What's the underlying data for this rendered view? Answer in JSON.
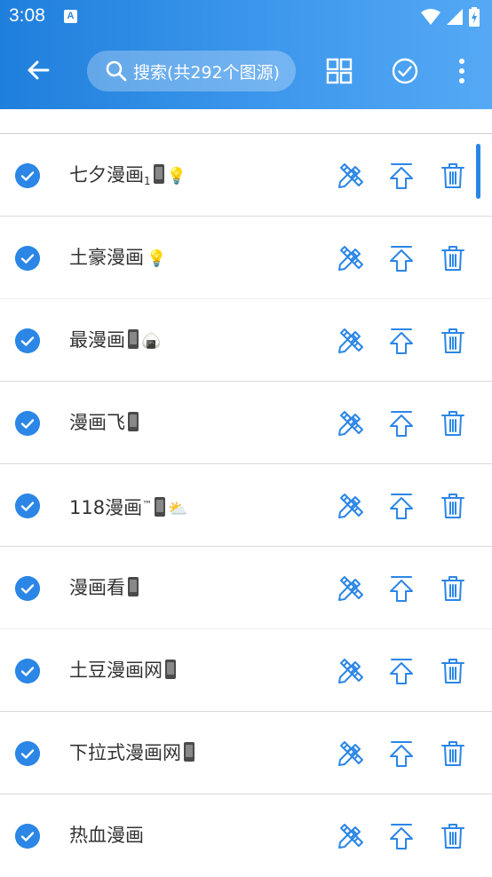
{
  "status_bar": {
    "time": "3:08",
    "notification_icon": "A"
  },
  "toolbar": {
    "search_placeholder": "搜索(共292个图源)",
    "back_icon": "arrow-left-icon",
    "grid_icon": "grid-icon",
    "select_all_icon": "check-circle-icon",
    "more_icon": "more-vert-icon"
  },
  "colors": {
    "accent": "#2b86e6",
    "appbar_start": "#1f7fdc",
    "appbar_end": "#55a9f5"
  },
  "sources": [
    {
      "pre": "七夕漫画",
      "sub": "1",
      "tm": "",
      "phone": true,
      "emoji": "💡"
    },
    {
      "pre": "土豪漫画",
      "sub": "",
      "tm": "",
      "phone": false,
      "emoji": "💡"
    },
    {
      "pre": "最漫画",
      "sub": "",
      "tm": "",
      "phone": true,
      "emoji": "🍙"
    },
    {
      "pre": "漫画飞",
      "sub": "",
      "tm": "",
      "phone": true,
      "emoji": ""
    },
    {
      "pre": "118漫画",
      "sub": "",
      "tm": "™",
      "phone": true,
      "emoji": "⛅"
    },
    {
      "pre": "漫画看",
      "sub": "",
      "tm": "",
      "phone": true,
      "emoji": ""
    },
    {
      "pre": "土豆漫画网",
      "sub": "",
      "tm": "",
      "phone": true,
      "emoji": ""
    },
    {
      "pre": "下拉式漫画网",
      "sub": "",
      "tm": "",
      "phone": true,
      "emoji": ""
    },
    {
      "pre": "热血漫画",
      "sub": "",
      "tm": "",
      "phone": false,
      "emoji": ""
    }
  ]
}
